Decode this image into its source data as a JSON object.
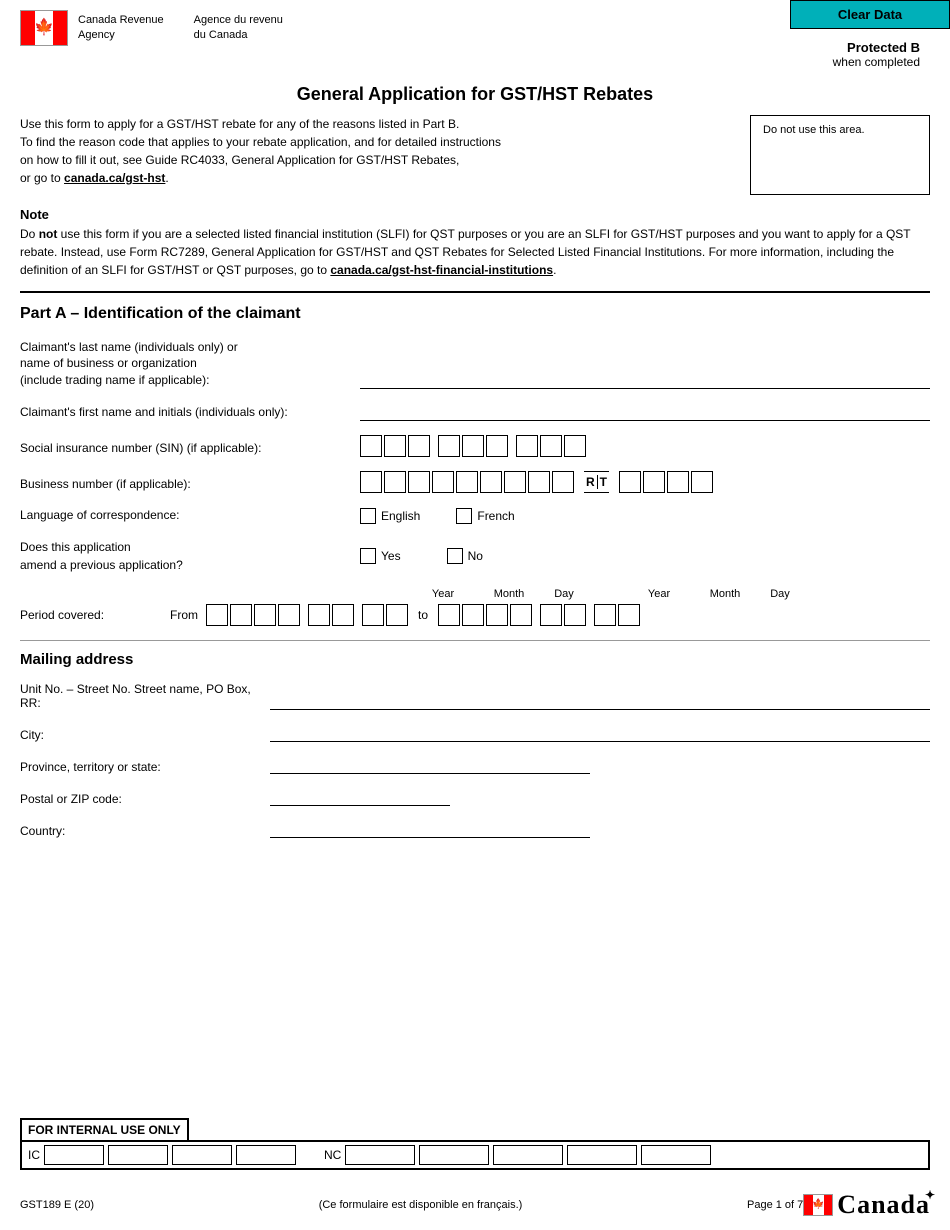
{
  "clearDataButton": "Clear Data",
  "header": {
    "agencyNameEn1": "Canada Revenue",
    "agencyNameEn2": "Agency",
    "agencyNameFr1": "Agence du revenu",
    "agencyNameFr2": "du Canada",
    "protectedB": "Protected B",
    "whenCompleted": "when completed"
  },
  "formTitle": "General Application for GST/HST Rebates",
  "instructions": {
    "text1": "Use this form to apply for a GST/HST rebate for any of the reasons listed in Part B.",
    "text2": "To find the reason code that applies to your rebate application, and for detailed instructions",
    "text3": "on how to fill it out, see Guide RC4033, General Application for GST/HST Rebates,",
    "text4": "or go to ",
    "link1": "canada.ca/gst-hst",
    "link1href": "canada.ca/gst-hst",
    "doNotUse": "Do not use this area."
  },
  "note": {
    "title": "Note",
    "bold": "not",
    "text": "Do not use this form if you are a selected listed financial institution (SLFI) for QST purposes or you are an SLFI for GST/HST purposes and you want to apply for a QST rebate. Instead, use Form RC7289, General Application for GST/HST and QST Rebates for Selected Listed Financial Institutions. For more information, including the definition of an SLFI for GST/HST or QST purposes, go to ",
    "link2": "canada.ca/gst-hst-financial-institutions",
    "link2href": "canada.ca/gst-hst-financial-institutions"
  },
  "partA": {
    "heading": "Part A – Identification of the claimant",
    "fields": {
      "lastNameLabel": "Claimant's last name (individuals only) or\nname of business or organization\n(include trading name if applicable):",
      "firstNameLabel": "Claimant's first name and initials (individuals only):",
      "sinLabel": "Social insurance number (SIN) (if applicable):",
      "bnLabel": "Business number (if applicable):",
      "rtLabel": "R",
      "tLabel": "T",
      "languageLabel": "Language of correspondence:",
      "englishLabel": "English",
      "frenchLabel": "French",
      "amendLabel": "Does this application\namend a previous application?",
      "yesLabel": "Yes",
      "noLabel": "No",
      "periodLabel": "Period covered:",
      "fromLabel": "From",
      "toLabel": "to",
      "yearLabel": "Year",
      "monthLabel": "Month",
      "dayLabel": "Day"
    }
  },
  "mailingAddress": {
    "heading": "Mailing address",
    "streetLabel": "Unit No. – Street No. Street name, PO Box, RR:",
    "cityLabel": "City:",
    "provinceLabel": "Province, territory or state:",
    "postalLabel": "Postal or ZIP code:",
    "countryLabel": "Country:"
  },
  "internalUse": {
    "label": "FOR INTERNAL USE ONLY",
    "icLabel": "IC",
    "ncLabel": "NC"
  },
  "footer": {
    "formNumber": "GST189 E (20)",
    "frenchAvailable": "(Ce formulaire est disponible en français.)",
    "pageInfo": "Page 1 of 7",
    "canadaWordmark": "Canadä"
  }
}
